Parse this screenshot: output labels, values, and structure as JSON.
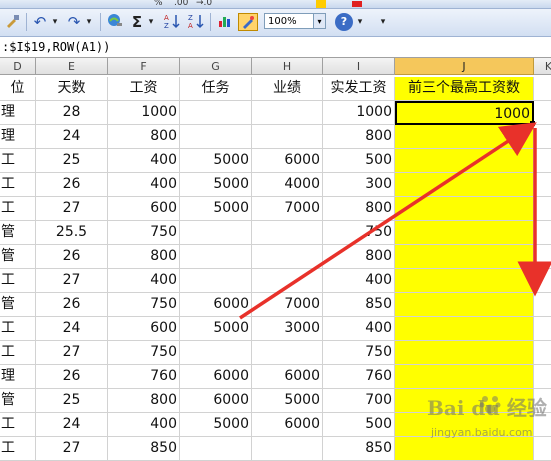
{
  "toolbar": {
    "zoom_value": "100%",
    "sigma_label": "Σ",
    "sigma_dd": "▾",
    "undo_icon": "↶",
    "redo_icon": "↷",
    "dd": "▾",
    "help_label": "?",
    "top_fragments": [
      "%",
      ".00",
      "→.0"
    ]
  },
  "formula_bar": {
    "text": ":$I$19,ROW(A1))"
  },
  "sheet": {
    "columns": [
      "D",
      "E",
      "F",
      "G",
      "H",
      "I",
      "J",
      "K"
    ],
    "rows": [
      [
        "位",
        "天数",
        "工资",
        "任务",
        "业绩",
        "实发工资",
        "前三个最高工资数",
        ""
      ],
      [
        "理",
        "28",
        "1000",
        "",
        "",
        "1000",
        "1000",
        ""
      ],
      [
        "理",
        "24",
        "800",
        "",
        "",
        "800",
        "",
        ""
      ],
      [
        "工",
        "25",
        "400",
        "5000",
        "6000",
        "500",
        "",
        ""
      ],
      [
        "工",
        "26",
        "400",
        "5000",
        "4000",
        "300",
        "",
        ""
      ],
      [
        "工",
        "27",
        "600",
        "5000",
        "7000",
        "800",
        "",
        ""
      ],
      [
        "管",
        "25.5",
        "750",
        "",
        "",
        "750",
        "",
        ""
      ],
      [
        "管",
        "26",
        "800",
        "",
        "",
        "800",
        "",
        ""
      ],
      [
        "工",
        "27",
        "400",
        "",
        "",
        "400",
        "",
        ""
      ],
      [
        "管",
        "26",
        "750",
        "6000",
        "7000",
        "850",
        "",
        ""
      ],
      [
        "工",
        "24",
        "600",
        "5000",
        "3000",
        "400",
        "",
        ""
      ],
      [
        "工",
        "27",
        "750",
        "",
        "",
        "750",
        "",
        ""
      ],
      [
        "理",
        "26",
        "760",
        "6000",
        "6000",
        "760",
        "",
        ""
      ],
      [
        "管",
        "25",
        "800",
        "6000",
        "5000",
        "700",
        "",
        ""
      ],
      [
        "工",
        "24",
        "400",
        "5000",
        "6000",
        "500",
        "",
        ""
      ],
      [
        "工",
        "27",
        "850",
        "",
        "",
        "850",
        "",
        ""
      ]
    ]
  },
  "watermark": {
    "brand": "Bai du 经验",
    "site": "jingyan.baidu.com"
  },
  "colors": {
    "highlight": "#ffff00",
    "arrow": "#e8312a",
    "selected_header": "#f5c75b"
  }
}
